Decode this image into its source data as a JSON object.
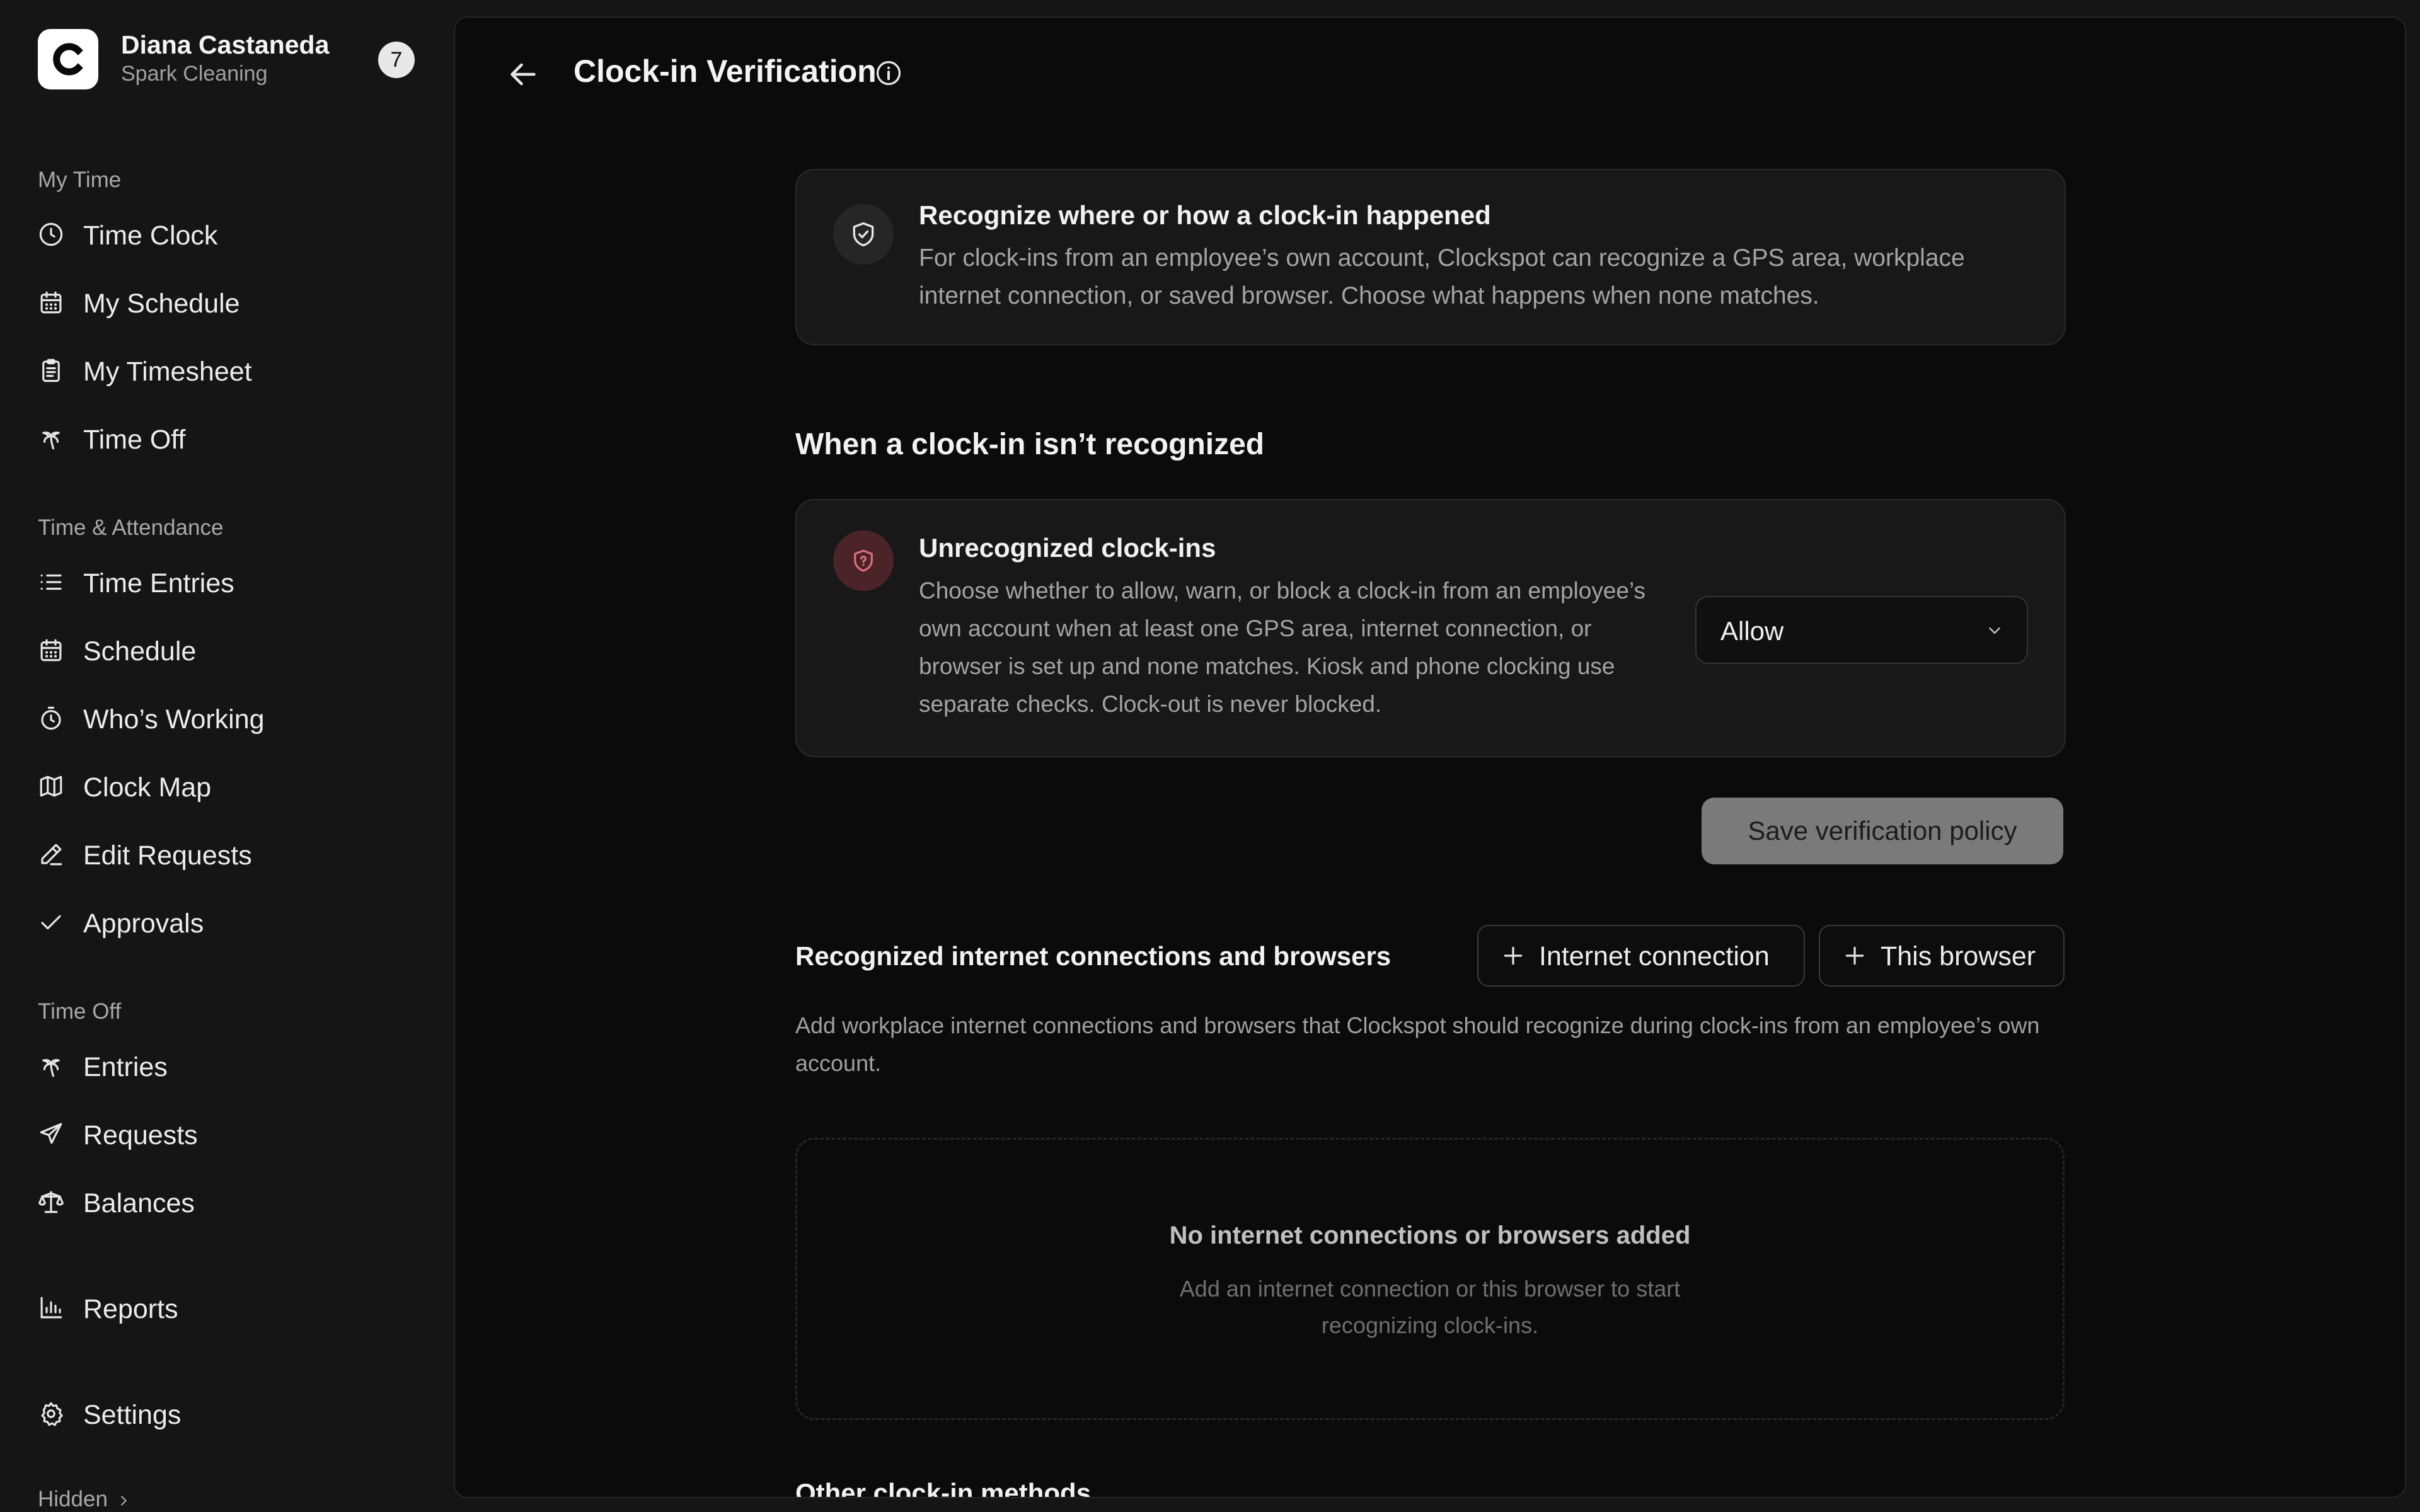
{
  "user": {
    "name": "Diana Castaneda",
    "org": "Spark Cleaning",
    "badge": "7"
  },
  "sidebar": {
    "sections": {
      "my_time": "My Time",
      "time_attendance": "Time & Attendance",
      "time_off": "Time Off"
    },
    "items": {
      "time_clock": "Time Clock",
      "my_schedule": "My Schedule",
      "my_timesheet": "My Timesheet",
      "time_off": "Time Off",
      "time_entries": "Time Entries",
      "schedule": "Schedule",
      "whos_working": "Who’s Working",
      "clock_map": "Clock Map",
      "edit_requests": "Edit Requests",
      "approvals": "Approvals",
      "entries": "Entries",
      "requests": "Requests",
      "balances": "Balances",
      "reports": "Reports",
      "settings": "Settings"
    },
    "hidden": "Hidden"
  },
  "page": {
    "title": "Clock-in Verification"
  },
  "intro_card": {
    "title": "Recognize where or how a clock-in happened",
    "description": "For clock-ins from an employee’s own account, Clockspot can recognize a GPS area, workplace internet connection, or saved browser. Choose what happens when none matches."
  },
  "unrecognized": {
    "heading": "When a clock-in isn’t recognized",
    "card_title": "Unrecognized clock-ins",
    "card_description": "Choose whether to allow, warn, or block a clock-in from an employee’s own account when at least one GPS area, internet connection, or browser is set up and none matches. Kiosk and phone clocking use separate checks. Clock-out is never blocked.",
    "select_value": "Allow",
    "save_label": "Save verification policy"
  },
  "recognized": {
    "heading": "Recognized internet connections and browsers",
    "add_connection_label": "Internet connection",
    "add_browser_label": "This browser",
    "help": "Add workplace internet connections and browsers that Clockspot should recognize during clock-ins from an employee’s own account.",
    "empty_title": "No internet connections or browsers added",
    "empty_desc": "Add an internet connection or this browser to start recognizing clock-ins."
  },
  "other_methods": {
    "heading": "Other clock-in methods"
  },
  "colors": {
    "background": "#151515",
    "panel": "#0b0b0b",
    "card": "#181818",
    "warning_icon_bg": "#4a2428",
    "warning_icon": "#e0707a",
    "disabled_button": "#7a7a7a"
  }
}
